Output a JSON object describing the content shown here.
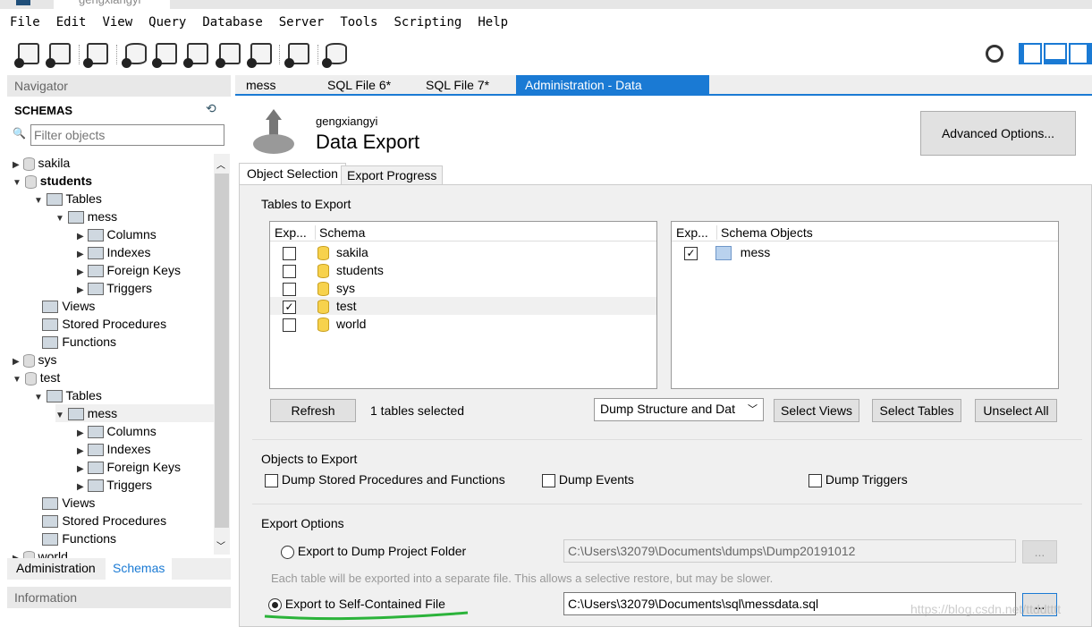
{
  "window": {
    "title": "gengxiangyi"
  },
  "menu": [
    "File",
    "Edit",
    "View",
    "Query",
    "Database",
    "Server",
    "Tools",
    "Scripting",
    "Help"
  ],
  "navigator": {
    "title": "Navigator",
    "schemas_label": "SCHEMAS",
    "filter_placeholder": "Filter objects",
    "tree": [
      {
        "label": "sakila",
        "level": 0,
        "type": "db",
        "state": "collapsed"
      },
      {
        "label": "students",
        "level": 0,
        "type": "db",
        "state": "expanded",
        "bold": true
      },
      {
        "label": "Tables",
        "level": 1,
        "type": "folder",
        "state": "expanded"
      },
      {
        "label": "mess",
        "level": 2,
        "type": "table",
        "state": "expanded"
      },
      {
        "label": "Columns",
        "level": 3,
        "type": "folder",
        "state": "collapsed"
      },
      {
        "label": "Indexes",
        "level": 3,
        "type": "folder",
        "state": "collapsed"
      },
      {
        "label": "Foreign Keys",
        "level": 3,
        "type": "folder",
        "state": "collapsed"
      },
      {
        "label": "Triggers",
        "level": 3,
        "type": "folder",
        "state": "collapsed"
      },
      {
        "label": "Views",
        "level": 1,
        "type": "folder",
        "state": "none"
      },
      {
        "label": "Stored Procedures",
        "level": 1,
        "type": "folder",
        "state": "none"
      },
      {
        "label": "Functions",
        "level": 1,
        "type": "folder",
        "state": "none"
      },
      {
        "label": "sys",
        "level": 0,
        "type": "db",
        "state": "collapsed"
      },
      {
        "label": "test",
        "level": 0,
        "type": "db",
        "state": "expanded"
      },
      {
        "label": "Tables",
        "level": 1,
        "type": "folder",
        "state": "expanded"
      },
      {
        "label": "mess",
        "level": 2,
        "type": "table",
        "state": "expanded",
        "selected": true
      },
      {
        "label": "Columns",
        "level": 3,
        "type": "folder",
        "state": "collapsed"
      },
      {
        "label": "Indexes",
        "level": 3,
        "type": "folder",
        "state": "collapsed"
      },
      {
        "label": "Foreign Keys",
        "level": 3,
        "type": "folder",
        "state": "collapsed"
      },
      {
        "label": "Triggers",
        "level": 3,
        "type": "folder",
        "state": "collapsed"
      },
      {
        "label": "Views",
        "level": 1,
        "type": "folder",
        "state": "none"
      },
      {
        "label": "Stored Procedures",
        "level": 1,
        "type": "folder",
        "state": "none"
      },
      {
        "label": "Functions",
        "level": 1,
        "type": "folder",
        "state": "none"
      },
      {
        "label": "world",
        "level": 0,
        "type": "db",
        "state": "collapsed"
      }
    ],
    "bottom_tabs": [
      "Administration",
      "Schemas"
    ],
    "info_title": "Information"
  },
  "tabs": [
    "mess",
    "SQL File 6*",
    "SQL File 7*",
    "Administration - Data Export"
  ],
  "header": {
    "subtitle": "gengxiangyi",
    "title": "Data Export",
    "advanced_button": "Advanced Options..."
  },
  "subtabs": [
    "Object Selection",
    "Export Progress"
  ],
  "tables_to_export": {
    "title": "Tables to Export",
    "left_headers": [
      "Exp...",
      "Schema"
    ],
    "schemas": [
      {
        "name": "sakila",
        "checked": false
      },
      {
        "name": "students",
        "checked": false
      },
      {
        "name": "sys",
        "checked": false
      },
      {
        "name": "test",
        "checked": true
      },
      {
        "name": "world",
        "checked": false
      }
    ],
    "right_headers": [
      "Exp...",
      "Schema Objects"
    ],
    "objects": [
      {
        "name": "mess",
        "checked": true
      }
    ],
    "refresh": "Refresh",
    "selected_count": "1 tables selected",
    "dump_mode": "Dump Structure and Dat",
    "select_views": "Select Views",
    "select_tables": "Select Tables",
    "unselect_all": "Unselect All"
  },
  "objects_to_export": {
    "title": "Objects to Export",
    "items": [
      "Dump Stored Procedures and Functions",
      "Dump Events",
      "Dump Triggers"
    ]
  },
  "export_options": {
    "title": "Export Options",
    "folder_option": "Export to Dump Project Folder",
    "folder_path": "C:\\Users\\32079\\Documents\\dumps\\Dump20191012",
    "folder_note": "Each table will be exported into a separate file. This allows a selective restore, but may be slower.",
    "file_option": "Export to Self-Contained File",
    "file_path": "C:\\Users\\32079\\Documents\\sql\\messdata.sql",
    "browse": "...",
    "selected": "file"
  },
  "watermark": "https://blog.csdn.net/ttddtttt"
}
